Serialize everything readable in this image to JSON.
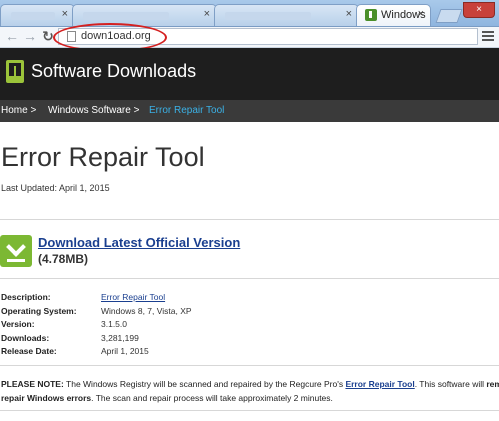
{
  "browser": {
    "active_tab_title": "Windows",
    "tab_close_glyph": "×",
    "url": "down1oad.org",
    "window_close_glyph": "×"
  },
  "site": {
    "name": "Software Downloads",
    "logo_icon": "download-logo-icon",
    "brand_color": "#9bc43a",
    "header_bg": "#1e1e1e"
  },
  "breadcrumb": {
    "items": [
      {
        "label": "Home >"
      },
      {
        "label": "Windows Software >"
      },
      {
        "label": "Error Repair Tool"
      }
    ],
    "current_color": "#3bb1e6"
  },
  "page": {
    "title": "Error Repair Tool",
    "last_updated": "Last Updated: April 1, 2015"
  },
  "download": {
    "link_label": "Download Latest Official Version",
    "size": "(4.78MB)",
    "icon": "download-arrow-icon"
  },
  "details": [
    {
      "label": "Description:",
      "value": "Error Repair Tool",
      "is_link": true
    },
    {
      "label": "Operating System:",
      "value": "Windows 8, 7, Vista, XP",
      "is_link": false
    },
    {
      "label": "Version:",
      "value": "3.1.5.0",
      "is_link": false
    },
    {
      "label": "Downloads:",
      "value": "3,281,199",
      "is_link": false
    },
    {
      "label": "Release Date:",
      "value": "April 1, 2015",
      "is_link": false
    }
  ],
  "note": {
    "prefix": "PLEASE NOTE:",
    "text1": " The Windows Registry will be scanned and repaired by the Regcure Pro's ",
    "link": "Error Repair Tool",
    "text2": ". This software will ",
    "bold_end": "remove",
    "line2_bold": "repair Windows errors",
    "line2_text": ". The scan and repair process will take approximately 2 minutes."
  }
}
